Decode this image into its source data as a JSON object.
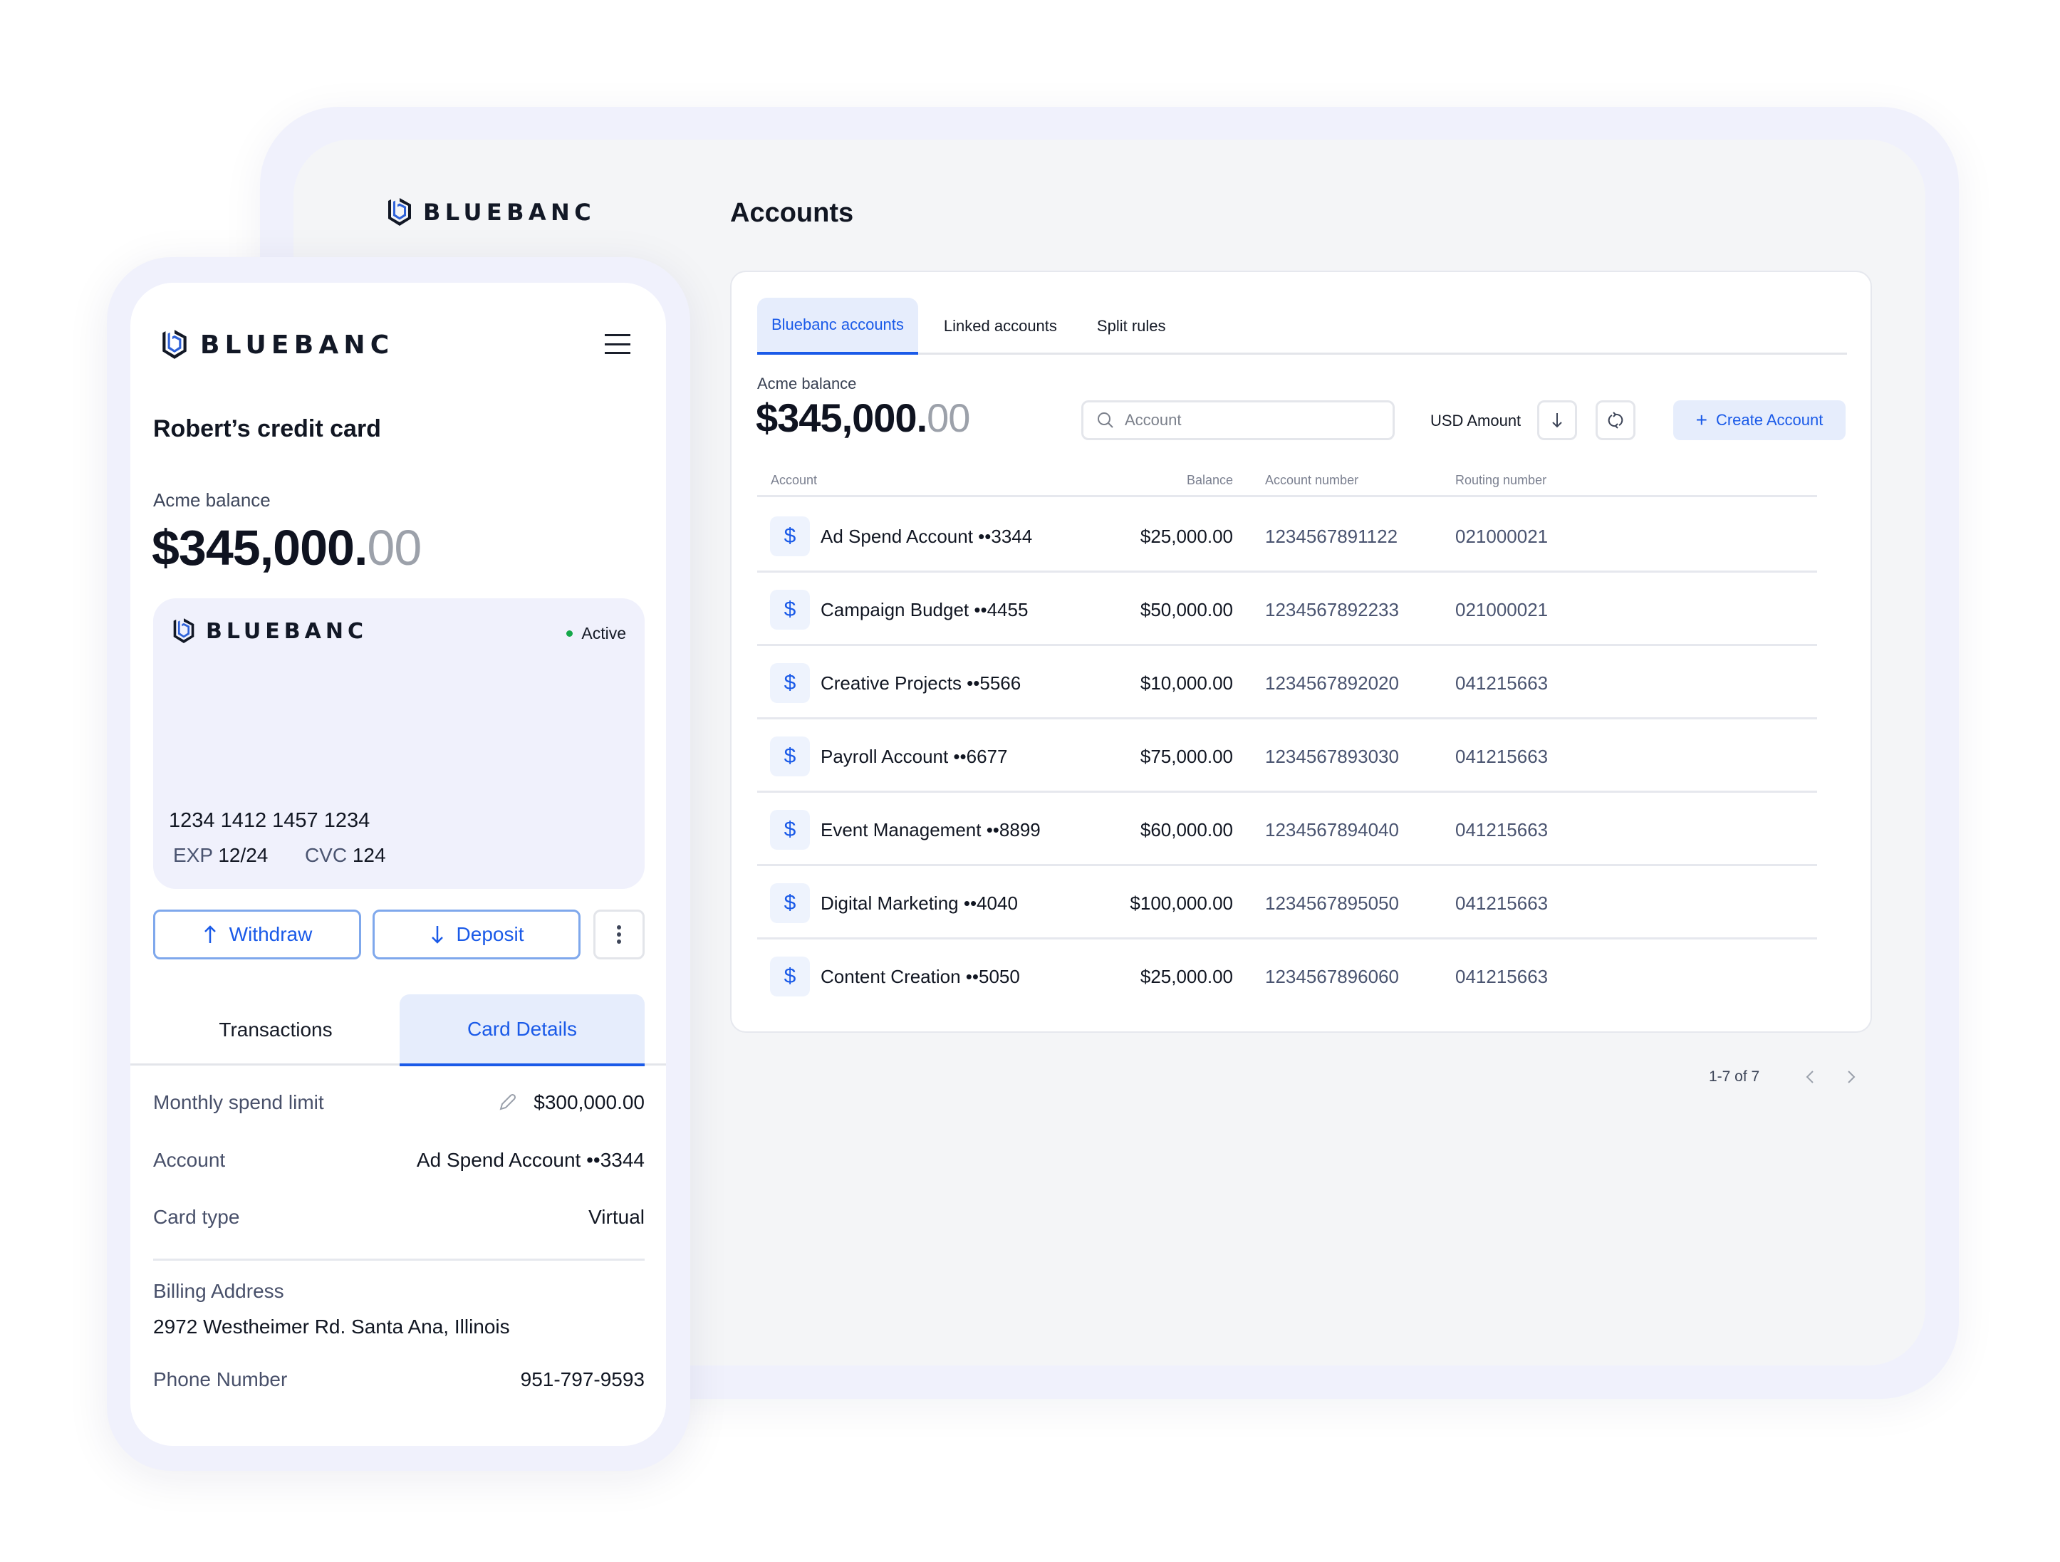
{
  "brand": {
    "name": "BLUEBANC",
    "accent_color": "#1a5ae8",
    "active_color": "#15a84a"
  },
  "desktop": {
    "page_title": "Accounts",
    "tabs": [
      {
        "label": "Bluebanc accounts",
        "active": true
      },
      {
        "label": "Linked accounts",
        "active": false
      },
      {
        "label": "Split rules",
        "active": false
      }
    ],
    "balance": {
      "label": "Acme balance",
      "whole": "$345,000.",
      "cents": "00"
    },
    "search": {
      "placeholder": "Account",
      "value": ""
    },
    "sort": {
      "label": "USD Amount",
      "sort_icon": "arrow-down-icon",
      "refresh_icon": "refresh-icon"
    },
    "create_button": {
      "label": "Create Account",
      "icon": "plus-icon"
    },
    "table": {
      "columns": [
        "Account",
        "Balance",
        "Account number",
        "Routing number"
      ],
      "rows": [
        {
          "icon": "$",
          "account": "Ad Spend Account ••3344",
          "balance": "$25,000.00",
          "account_number": "1234567891122",
          "routing_number": "021000021"
        },
        {
          "icon": "$",
          "account": "Campaign Budget ••4455",
          "balance": "$50,000.00",
          "account_number": "1234567892233",
          "routing_number": "021000021"
        },
        {
          "icon": "$",
          "account": "Creative Projects ••5566",
          "balance": "$10,000.00",
          "account_number": "1234567892020",
          "routing_number": "041215663"
        },
        {
          "icon": "$",
          "account": "Payroll Account ••6677",
          "balance": "$75,000.00",
          "account_number": "1234567893030",
          "routing_number": "041215663"
        },
        {
          "icon": "$",
          "account": "Event Management ••8899",
          "balance": "$60,000.00",
          "account_number": "1234567894040",
          "routing_number": "041215663"
        },
        {
          "icon": "$",
          "account": "Digital Marketing ••4040",
          "balance": "$100,000.00",
          "account_number": "1234567895050",
          "routing_number": "041215663"
        },
        {
          "icon": "$",
          "account": "Content Creation ••5050",
          "balance": "$25,000.00",
          "account_number": "1234567896060",
          "routing_number": "041215663"
        }
      ]
    },
    "pagination": {
      "label": "1-7 of 7"
    }
  },
  "mobile": {
    "title": "Robert’s credit card",
    "balance": {
      "label": "Acme balance",
      "whole": "$345,000.",
      "cents": "00"
    },
    "card": {
      "status": "Active",
      "number": "1234 1412 1457 1234",
      "exp_label": "EXP",
      "exp_value": "12/24",
      "cvc_label": "CVC",
      "cvc_value": "124"
    },
    "actions": {
      "withdraw": "Withdraw",
      "deposit": "Deposit"
    },
    "tabs": [
      {
        "label": "Transactions",
        "active": false
      },
      {
        "label": "Card Details",
        "active": true
      }
    ],
    "details": {
      "monthly_limit": {
        "label": "Monthly spend limit",
        "value": "$300,000.00"
      },
      "account": {
        "label": "Account",
        "value": "Ad Spend Account ••3344"
      },
      "card_type": {
        "label": "Card type",
        "value": "Virtual"
      },
      "billing": {
        "label": "Billing Address",
        "value": "2972 Westheimer Rd. Santa Ana, Illinois"
      },
      "phone": {
        "label": "Phone Number",
        "value": "951-797-9593"
      }
    }
  }
}
